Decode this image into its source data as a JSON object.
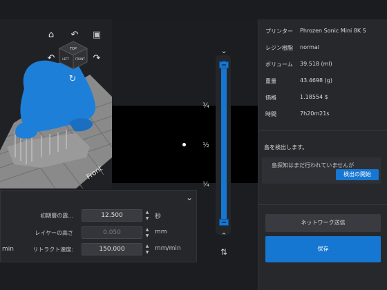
{
  "viewport": {
    "view_nav": {
      "home_icon": "⌂",
      "rotate_left_icon": "↶",
      "rotate_right_icon": "↷",
      "rotate_down_left_icon": "↶",
      "rotate_down_right_icon": "↷",
      "rotate_bottom_icon": "↻",
      "cube_icon": "▣",
      "cube_top": "TOP",
      "cube_left": "LEFT",
      "cube_front": "FRONT"
    },
    "plate_label": "Front",
    "layer_ticks": [
      "¾",
      "½",
      "¼"
    ],
    "slider_up_icon": "⌃",
    "slider_down_icon": "⌃",
    "slider_toggle_icon": "⇅",
    "collapse_icon": "⌄"
  },
  "settings": {
    "rows": [
      {
        "label": "初期層の露...",
        "value": "12.500",
        "unit": "秒",
        "disabled": false
      },
      {
        "label": "レイヤーの高さ",
        "value": "0.050",
        "unit": "mm",
        "disabled": true
      },
      {
        "label": "リトラクト速度:",
        "value": "150.000",
        "unit": "mm/min",
        "disabled": false
      }
    ],
    "left_fragment": "min"
  },
  "info": {
    "rows": [
      {
        "key": "プリンター",
        "value": "Phrozen Sonic Mini 8K S"
      },
      {
        "key": "レジン樹脂",
        "value": "normal"
      },
      {
        "key": "ボリューム",
        "value": "39.518 (ml)"
      },
      {
        "key": "重量",
        "value": "43.4698 (g)"
      },
      {
        "key": "価格",
        "value": "1.18554 $"
      },
      {
        "key": "時間",
        "value": "7h20m21s"
      }
    ]
  },
  "detection": {
    "title": "島を検出します。",
    "message": "島探知はまだ行われていませんが",
    "button": "検出の開始"
  },
  "actions": {
    "network_send": "ネットワーク送信",
    "save": "保存"
  },
  "colors": {
    "accent": "#1677d2",
    "model": "#1e7fd8",
    "plate": "#8c8c8c",
    "background": "#1e1f22"
  }
}
